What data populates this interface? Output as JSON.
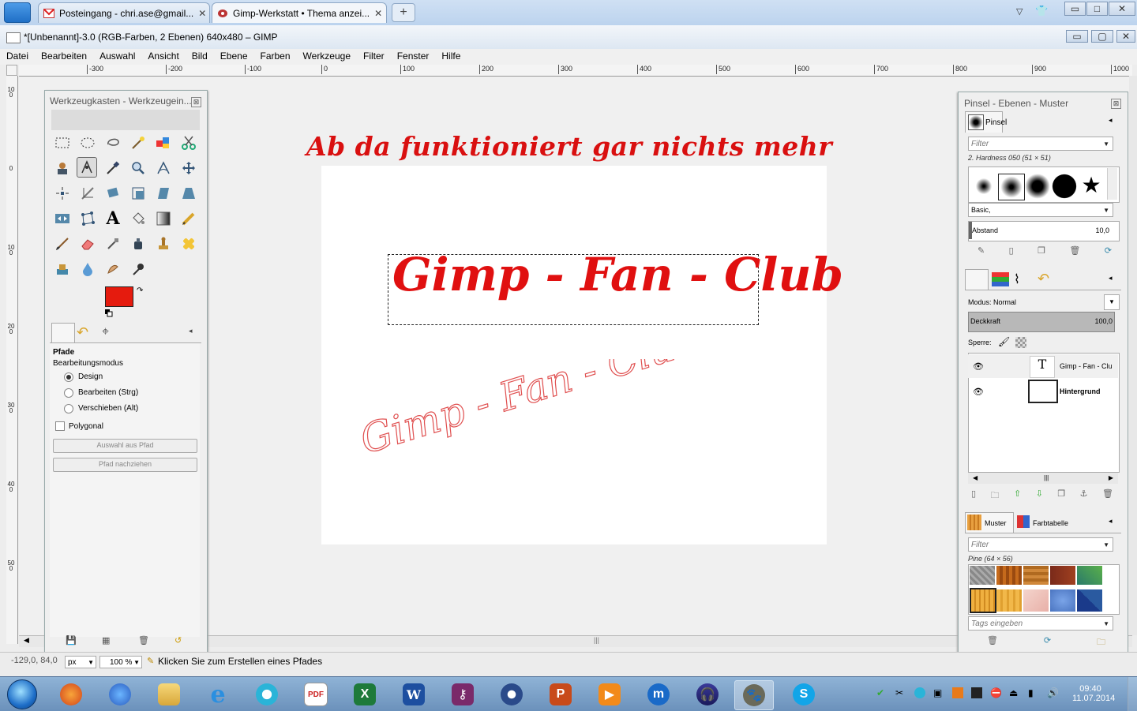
{
  "browser": {
    "tabs": [
      {
        "label": "Posteingang - chri.ase@gmail...",
        "icon": "gmail-icon"
      },
      {
        "label": "Gimp-Werkstatt • Thema anzei...",
        "icon": "gimp-werkstatt-icon"
      }
    ],
    "new_tab": "+",
    "window_buttons": [
      "▭",
      "□",
      "✕"
    ]
  },
  "gimp": {
    "title": "*[Unbenannt]-3.0 (RGB-Farben, 2 Ebenen) 640x480 – GIMP",
    "menu": [
      "Datei",
      "Bearbeiten",
      "Auswahl",
      "Ansicht",
      "Bild",
      "Ebene",
      "Farben",
      "Werkzeuge",
      "Filter",
      "Fenster",
      "Hilfe"
    ],
    "ruler_labels": [
      "-300",
      "-200",
      "-100",
      "0",
      "100",
      "200",
      "300",
      "400",
      "500",
      "600",
      "700",
      "800",
      "900",
      "1000"
    ],
    "vruler_labels": [
      "100",
      "0",
      "100",
      "200",
      "300",
      "400",
      "500"
    ]
  },
  "canvas": {
    "annotation": "Ab da funktioniert gar nichts mehr",
    "main_text": "Gimp - Fan - Club",
    "outline_text": "Gimp - Fan - Club",
    "colors": {
      "text_red": "#e01010",
      "heading_red": "#d91010",
      "outline_red": "#e05050"
    }
  },
  "toolbox": {
    "title": "Werkzeugkasten - Werkzeugein...",
    "fg_color": "#e51b0e",
    "bg_color": "#ffffff",
    "options_title": "Pfade",
    "mode_label": "Bearbeitungsmodus",
    "modes": [
      {
        "label": "Design",
        "selected": true
      },
      {
        "label": "Bearbeiten (Strg)",
        "selected": false
      },
      {
        "label": "Verschieben (Alt)",
        "selected": false
      }
    ],
    "polygonal": "Polygonal",
    "btn_selection": "Auswahl aus Pfad",
    "btn_stroke": "Pfad nachziehen"
  },
  "dock": {
    "title": "Pinsel - Ebenen - Muster",
    "brushes_tab": "Pinsel",
    "filter_placeholder": "Filter",
    "brush_name": "2. Hardness 050 (51 × 51)",
    "brush_tag": "Basic,",
    "spacing_label": "Abstand",
    "spacing_value": "10,0",
    "mode_label": "Modus:",
    "mode_value": "Normal",
    "opacity_label": "Deckkraft",
    "opacity_value": "100,0",
    "lock_label": "Sperre:",
    "layers": [
      {
        "name": "Gimp - Fan - Clu",
        "bold": false
      },
      {
        "name": "Hintergrund",
        "bold": true
      }
    ],
    "patterns_tab": "Muster",
    "palette_tab": "Farbtabelle",
    "pattern_name": "Pine (64 × 56)",
    "tags_placeholder": "Tags eingeben"
  },
  "status": {
    "coords": "-129,0, 84,0",
    "unit": "px",
    "zoom": "100 %",
    "message": "Klicken Sie zum Erstellen eines Pfades"
  },
  "taskbar": {
    "time": "09:40",
    "date": "11.07.2014"
  }
}
